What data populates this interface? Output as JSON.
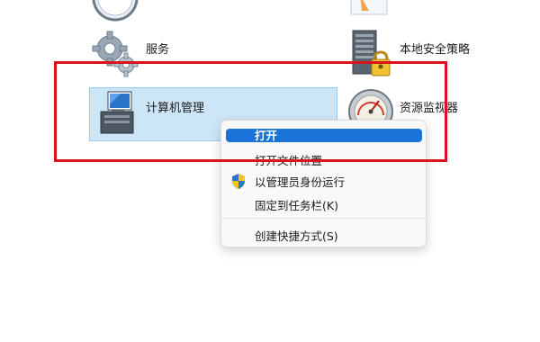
{
  "items": {
    "services": {
      "label": "服务",
      "icon": "gear-icon"
    },
    "local_security_policy": {
      "label": "本地安全策略",
      "icon": "server-lock-icon"
    },
    "computer_management": {
      "label": "计算机管理",
      "icon": "computer-management-icon"
    },
    "resource_monitor": {
      "label": "资源监视器",
      "icon": "gauge-icon"
    }
  },
  "context_menu": {
    "open": "打开",
    "open_file_location": "打开文件位置",
    "run_as_admin": "以管理员身份运行",
    "pin_to_taskbar": "固定到任务栏(K)",
    "create_shortcut": "创建快捷方式(S)"
  },
  "colors": {
    "annotation_red": "#d9141c",
    "selection_bg": "#cde6f7",
    "menu_highlight": "#1a73d9"
  }
}
